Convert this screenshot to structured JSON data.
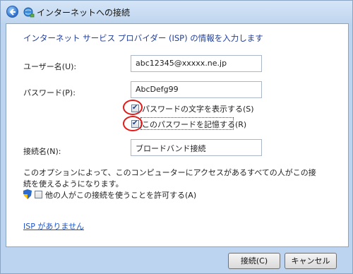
{
  "window": {
    "title": "インターネットへの接続"
  },
  "form": {
    "heading": "インターネット サービス プロバイダー (ISP) の情報を入力します",
    "username_label": "ユーザー名(U):",
    "username_value": "abc12345@xxxxx.ne.jp",
    "password_label": "パスワード(P):",
    "password_value": "AbcDefg99",
    "show_chars_label": "パスワードの文字を表示する(S)",
    "show_chars_checked": true,
    "remember_label": "このパスワードを記憶する(R)",
    "remember_checked": true,
    "connection_name_label": "接続名(N):",
    "connection_name_value": "ブロードバンド接続",
    "info_text": "このオプションによって、このコンピューターにアクセスがあるすべての人がこの接続を使えるようになります。",
    "allow_others_label": "他の人がこの接続を使うことを許可する(A)",
    "allow_others_checked": false,
    "no_isp_link": "ISP がありません"
  },
  "buttons": {
    "connect": "接続(C)",
    "cancel": "キャンセル"
  },
  "colors": {
    "heading": "#1f3e9b",
    "link": "#1f54c7",
    "annotation_circle": "#e11a1a"
  }
}
